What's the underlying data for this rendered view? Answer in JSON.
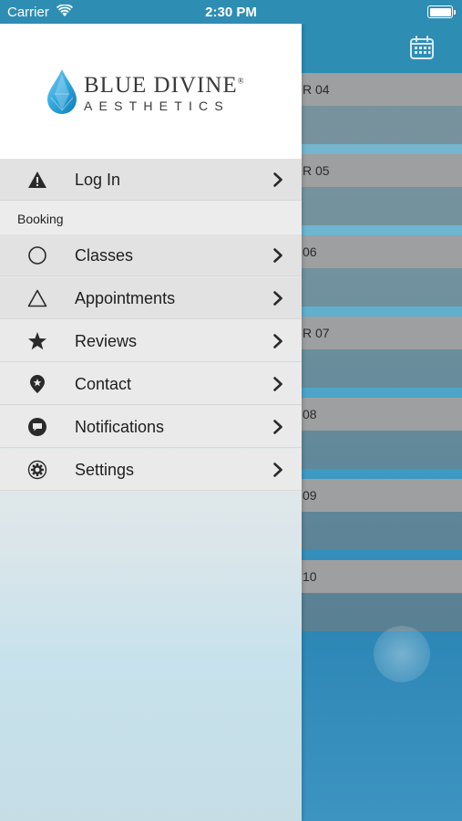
{
  "status_bar": {
    "carrier": "Carrier",
    "time": "2:30 PM",
    "wifi_icon": "wifi-icon",
    "battery_icon": "battery-icon"
  },
  "schedule": {
    "calendar_icon": "calendar-icon",
    "days": [
      {
        "label": "R 04"
      },
      {
        "label": "R 05"
      },
      {
        "label": "06"
      },
      {
        "label": "R 07"
      },
      {
        "label": "08"
      },
      {
        "label": "09"
      },
      {
        "label": "10"
      }
    ]
  },
  "drawer": {
    "logo": {
      "main": "BLUE DIVINE",
      "registered": "®",
      "sub": "AESTHETICS",
      "icon": "water-drop-logo-icon"
    },
    "login": {
      "label": "Log In",
      "icon": "warning-icon"
    },
    "section": "Booking",
    "items": [
      {
        "label": "Classes",
        "icon": "circle-icon"
      },
      {
        "label": "Appointments",
        "icon": "triangle-icon"
      },
      {
        "label": "Reviews",
        "icon": "star-icon"
      },
      {
        "label": "Contact",
        "icon": "location-pin-star-icon"
      },
      {
        "label": "Notifications",
        "icon": "message-bubble-icon"
      },
      {
        "label": "Settings",
        "icon": "gear-icon"
      }
    ]
  },
  "colors": {
    "brand_blue": "#2e8db3",
    "drawer_bg": "#eaeaea",
    "text": "#1e1e1e"
  }
}
